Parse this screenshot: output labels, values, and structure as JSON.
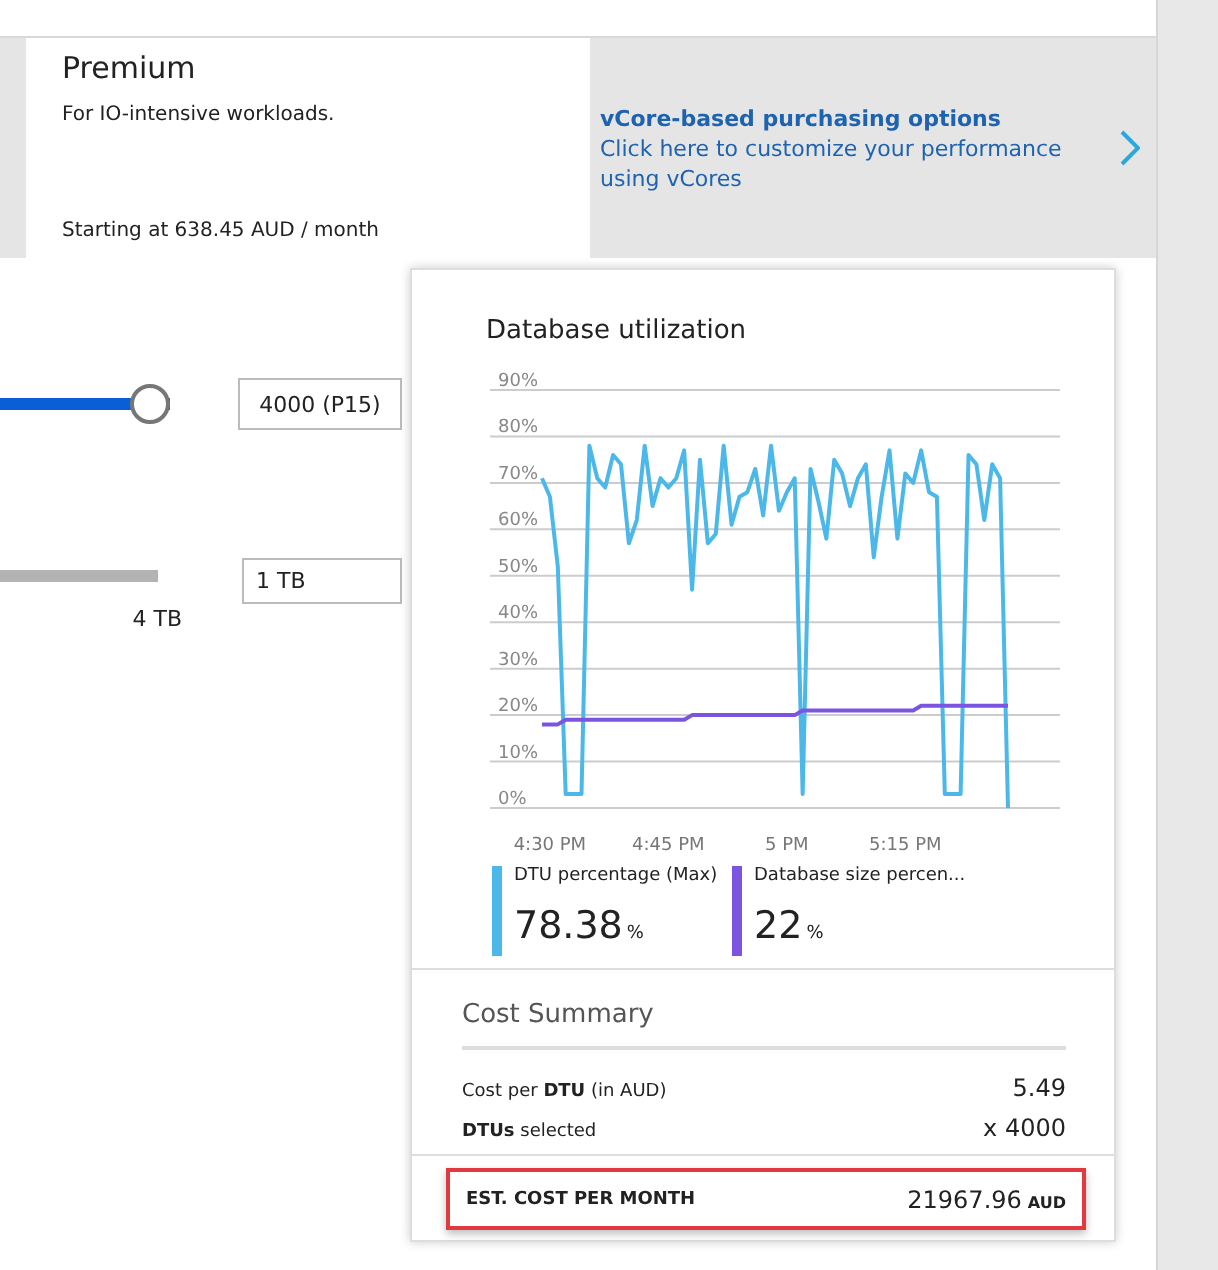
{
  "tier": {
    "name": "Premium",
    "description": "For IO-intensive workloads.",
    "price": "Starting at 638.45 AUD / month"
  },
  "vcore_link": {
    "title": "vCore-based purchasing options",
    "text": "Click here to customize your performance using vCores"
  },
  "dtu_slider": {
    "level": 1,
    "value": "4000 (P15)"
  },
  "storage_slider": {
    "level": 1,
    "max_label": "4 TB",
    "value": "1 TB"
  },
  "utilization": {
    "title": "Database utilization",
    "chart_data": {
      "type": "line",
      "categories": [
        null,
        "4:30 PM",
        null,
        null,
        null,
        null,
        null,
        null,
        null,
        null,
        null,
        null,
        null,
        null,
        null,
        null,
        "4:45 PM",
        null,
        null,
        null,
        null,
        null,
        null,
        null,
        null,
        null,
        null,
        null,
        null,
        null,
        null,
        "5 PM",
        null,
        null,
        null,
        null,
        null,
        null,
        null,
        null,
        null,
        null,
        null,
        null,
        null,
        null,
        "5:15 PM",
        null,
        null,
        null,
        null,
        null,
        null,
        null,
        null,
        null,
        null,
        null,
        null,
        null
      ],
      "series": [
        {
          "name": "DTU percentage (Max)",
          "color": "#4cb8ea",
          "values": [
            71,
            67,
            52,
            3,
            3,
            3,
            78,
            71,
            69,
            76,
            74,
            57,
            62,
            78,
            65,
            71,
            69,
            71,
            77,
            47,
            75,
            57,
            59,
            78,
            61,
            67,
            68,
            73,
            63,
            78,
            64,
            68,
            71,
            3,
            73,
            66,
            58,
            75,
            72,
            65,
            71,
            74,
            54,
            67,
            77,
            58,
            72,
            70,
            77,
            68,
            67,
            3,
            3,
            3,
            76,
            74,
            62,
            74,
            71,
            0
          ]
        },
        {
          "name": "Database size percen...",
          "color": "#7b55e0",
          "values": [
            18,
            18,
            18,
            19,
            19,
            19,
            19,
            19,
            19,
            19,
            19,
            19,
            19,
            19,
            19,
            19,
            19,
            19,
            19,
            20,
            20,
            20,
            20,
            20,
            20,
            20,
            20,
            20,
            20,
            20,
            20,
            20,
            20,
            21,
            21,
            21,
            21,
            21,
            21,
            21,
            21,
            21,
            21,
            21,
            21,
            21,
            21,
            21,
            22,
            22,
            22,
            22,
            22,
            22,
            22,
            22,
            22,
            22,
            22,
            22
          ]
        }
      ],
      "ylim": [
        0,
        90
      ],
      "grid": true,
      "yticks": [
        {
          "value": 0,
          "label": "0%"
        },
        {
          "value": 10,
          "label": "10%"
        },
        {
          "value": 20,
          "label": "20%"
        },
        {
          "value": 30,
          "label": "30%"
        },
        {
          "value": 40,
          "label": "40%"
        },
        {
          "value": 50,
          "label": "50%"
        },
        {
          "value": 60,
          "label": "60%"
        },
        {
          "value": 70,
          "label": "70%"
        },
        {
          "value": 80,
          "label": "80%"
        },
        {
          "value": 90,
          "label": "90%"
        }
      ]
    },
    "legend": [
      {
        "value": "78.38",
        "unit": "%"
      },
      {
        "value": "22",
        "unit": "%"
      }
    ]
  },
  "cost_summary": {
    "title": "Cost Summary",
    "rows": [
      {
        "label": "Cost per **DTU** (in AUD)",
        "value": "5.49"
      },
      {
        "label": "**DTUs** selected",
        "value": "x 4000"
      }
    ],
    "total": {
      "label": "EST. COST PER MONTH",
      "value": "21967.96",
      "unit": "AUD",
      "highlighted": true
    }
  }
}
